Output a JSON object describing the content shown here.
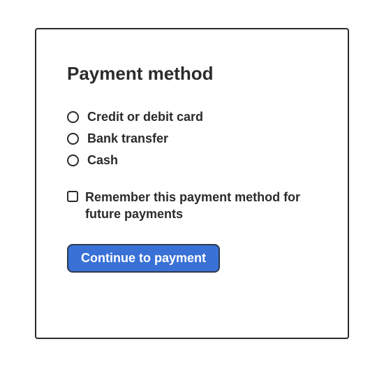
{
  "title": "Payment method",
  "options": [
    {
      "label": "Credit or debit card"
    },
    {
      "label": "Bank transfer"
    },
    {
      "label": "Cash"
    }
  ],
  "remember": {
    "label": "Remember this payment method for future payments"
  },
  "cta": {
    "label": "Continue to payment"
  }
}
